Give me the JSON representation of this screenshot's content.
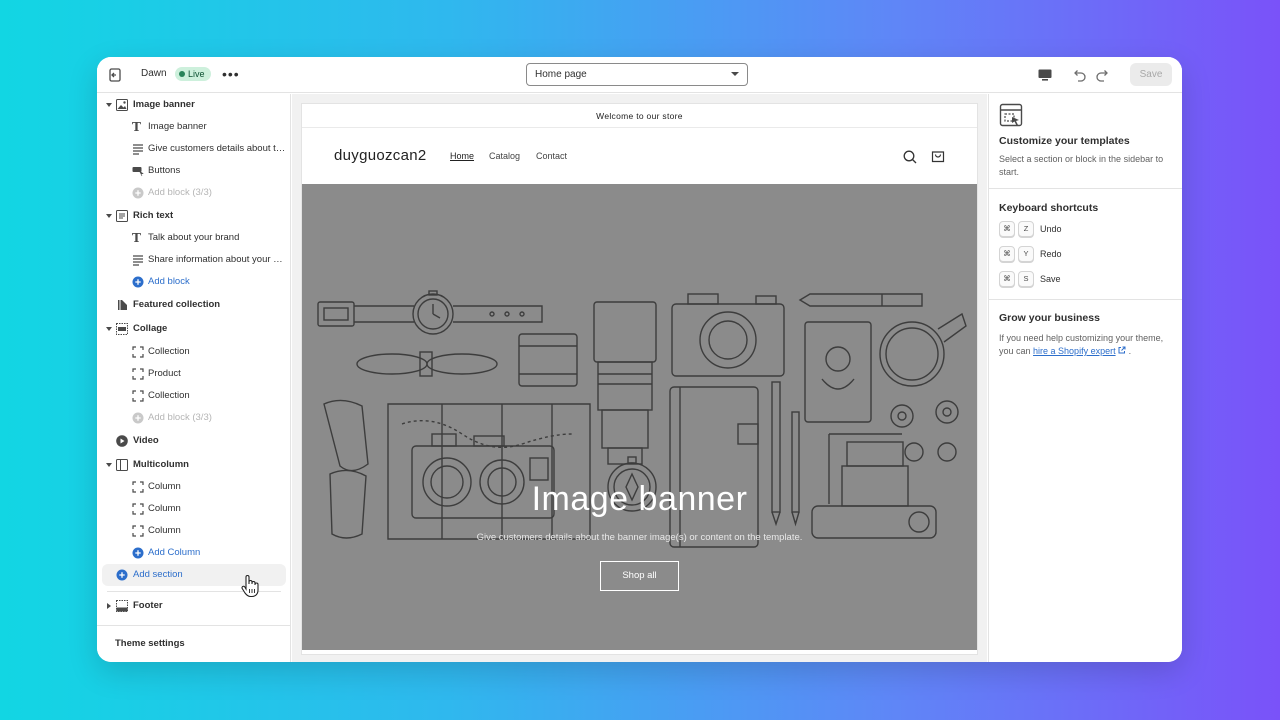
{
  "topbar": {
    "theme_name": "Dawn",
    "status_badge": "Live",
    "more_label": "•••",
    "page_select_value": "Home page",
    "save_label": "Save"
  },
  "sidebar": {
    "sections": [
      {
        "label": "Image banner",
        "icon": "image-icon",
        "blocks": [
          {
            "label": "Image banner",
            "icon": "text-icon"
          },
          {
            "label": "Give customers details about the banner image(s) or content on the template.",
            "icon": "paragraph-icon"
          },
          {
            "label": "Buttons",
            "icon": "buttons-icon"
          }
        ],
        "add_block": "Add block (3/3)"
      },
      {
        "label": "Rich text",
        "icon": "rich-text-icon",
        "blocks": [
          {
            "label": "Talk about your brand",
            "icon": "text-icon"
          },
          {
            "label": "Share information about your brand with your customers.",
            "icon": "paragraph-icon"
          }
        ],
        "add_block": "Add block"
      },
      {
        "label": "Featured collection",
        "icon": "tag-icon"
      },
      {
        "label": "Collage",
        "icon": "collage-icon",
        "blocks": [
          {
            "label": "Collection",
            "icon": "dashed-square-icon"
          },
          {
            "label": "Product",
            "icon": "dashed-square-icon"
          },
          {
            "label": "Collection",
            "icon": "dashed-square-icon"
          }
        ],
        "add_block": "Add block (3/3)"
      },
      {
        "label": "Video",
        "icon": "play-icon"
      },
      {
        "label": "Multicolumn",
        "icon": "columns-icon",
        "blocks": [
          {
            "label": "Column",
            "icon": "dashed-square-icon"
          },
          {
            "label": "Column",
            "icon": "dashed-square-icon"
          },
          {
            "label": "Column",
            "icon": "dashed-square-icon"
          }
        ],
        "add_block": "Add Column"
      }
    ],
    "add_section": "Add section",
    "footer": "Footer",
    "theme_settings": "Theme settings"
  },
  "preview": {
    "announcement": "Welcome to our store",
    "logo": "duyguozcan2",
    "nav": [
      "Home",
      "Catalog",
      "Contact"
    ],
    "banner_title": "Image banner",
    "banner_subtitle": "Give customers details about the banner image(s) or content on the template.",
    "banner_button": "Shop all"
  },
  "right_panel": {
    "customize_title": "Customize your templates",
    "customize_text": "Select a section or block in the sidebar to start.",
    "shortcuts_title": "Keyboard shortcuts",
    "shortcuts": [
      {
        "mod": "⌘",
        "key": "Z",
        "label": "Undo"
      },
      {
        "mod": "⌘",
        "key": "Y",
        "label": "Redo"
      },
      {
        "mod": "⌘",
        "key": "S",
        "label": "Save"
      }
    ],
    "grow_title": "Grow your business",
    "grow_text_before": "If you need help customizing your theme, you can ",
    "grow_link": "hire a Shopify expert",
    "grow_text_after": " ."
  },
  "colors": {
    "accent": "#2c6ecb",
    "live_badge": "#cdf0dc",
    "banner_overlay": "#8b8b8b"
  }
}
